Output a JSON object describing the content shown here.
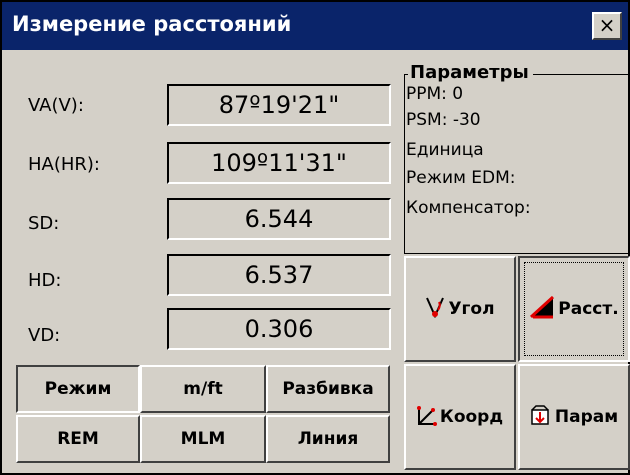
{
  "window": {
    "title": "Измерение расстояний",
    "close_label": "×"
  },
  "measurements": [
    {
      "label": "VA(V):",
      "value": "87º19'21\""
    },
    {
      "label": "HA(HR):",
      "value": "109º11'31\""
    },
    {
      "label": "SD:",
      "value": "6.544"
    },
    {
      "label": "HD:",
      "value": "6.537"
    },
    {
      "label": "VD:",
      "value": "0.306"
    }
  ],
  "params": {
    "title": "Параметры",
    "lines": [
      "PPM:   0",
      "PSM: -30",
      "Единица",
      "Режим EDM:",
      "Компенсатор:"
    ]
  },
  "buttons": {
    "mode": "Режим",
    "mft": "m/ft",
    "stakeout": "Разбивка",
    "rem": "REM",
    "mlm": "MLM",
    "line": "Линия",
    "angle": "Угол",
    "dist": "Расст.",
    "coord": "Коорд",
    "param": "Парам"
  },
  "icons": {
    "angle": "angle-v-icon",
    "dist": "distance-triangle-icon",
    "coord": "coordinate-icon",
    "param": "parameters-folder-icon"
  }
}
